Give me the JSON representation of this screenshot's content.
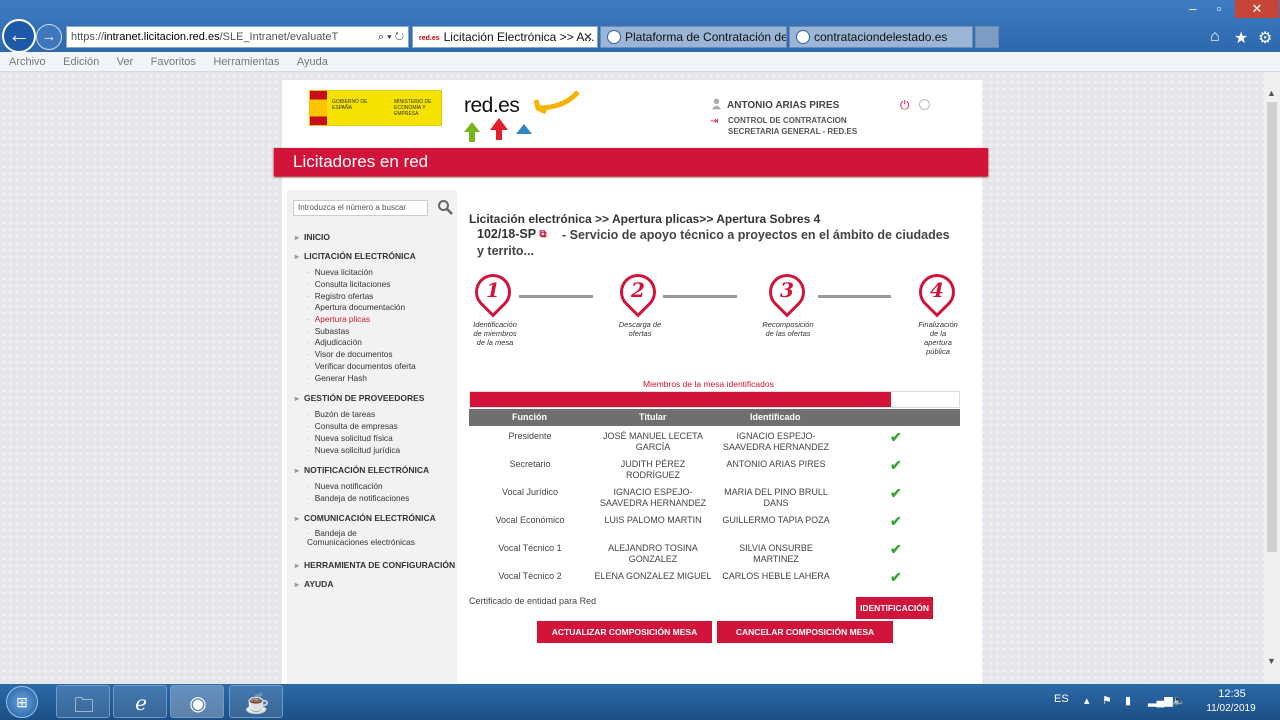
{
  "browser": {
    "address": {
      "prefix": "https://",
      "host": "intranet.licitacion.red.es",
      "path": "/SLE_Intranet/evaluateT",
      "controls": "⌕ ▾ ↻"
    },
    "tabs": [
      {
        "label": "Licitación Electrónica >> A...",
        "fav": "red.es",
        "active": true
      },
      {
        "label": "Plataforma de Contratación de...",
        "active": false
      },
      {
        "label": "contrataciondelestado.es",
        "active": false
      }
    ],
    "menu": [
      "Archivo",
      "Edición",
      "Ver",
      "Favoritos",
      "Herramientas",
      "Ayuda"
    ]
  },
  "header": {
    "gov_text_1": "GOBIERNO DE ESPAÑA",
    "gov_text_2": "MINISTERIO DE ECONOMÍA Y EMPRESA",
    "brand": "red.es",
    "user_name": "ANTONIO ARIAS PIRES",
    "user_role_1": "CONTROL DE CONTRATACION",
    "user_role_2": "SECRETARIA GENERAL  -  RED.ES"
  },
  "section_title": "Licitadores en red",
  "sidebar": {
    "search_placeholder": "Introduzca el número a buscar",
    "sections": [
      {
        "label": "INICIO",
        "items": []
      },
      {
        "label": "LICITACIÓN ELECTRÓNICA",
        "items": [
          "Nueva licitación",
          "Consulta licitaciones",
          "Registro ofertas",
          "Apertura documentación",
          "Apertura plicas",
          "Subastas",
          "Adjudicación",
          "Visor de documentos",
          "Verificar documentos oferta",
          "Generar Hash"
        ]
      },
      {
        "label": "GESTIÓN DE PROVEEDORES",
        "items": [
          "Buzón de tareas",
          "Consulta de empresas",
          "Nueva solicitud física",
          "Nueva solicitud jurídica"
        ]
      },
      {
        "label": "NOTIFICACIÓN ELECTRÓNICA",
        "items": [
          "Nueva notificación",
          "Bandeja de notificaciones"
        ]
      },
      {
        "label": "COMUNICACIÓN ELECTRÓNICA",
        "items": [
          "Bandeja de Comunicaciones electrónicas"
        ]
      },
      {
        "label": "HERRAMIENTA DE CONFIGURACIÓN",
        "items": []
      },
      {
        "label": "AYUDA",
        "items": []
      }
    ],
    "selected_item": "Apertura plicas"
  },
  "main": {
    "breadcrumb": "Licitación electrónica >> Apertura plicas>> Apertura Sobres 4",
    "expediente_id": "102/18-SP",
    "expediente_title": " -  Servicio de apoyo técnico a proyectos en el ámbito de ciudades y territo...",
    "steps": [
      {
        "num": "1",
        "label": "Identificación de miembros de la mesa"
      },
      {
        "num": "2",
        "label": "Descarga de ofertas"
      },
      {
        "num": "3",
        "label": "Recomposición de las ofertas"
      },
      {
        "num": "4",
        "label": "Finalización de la apertura pública"
      }
    ],
    "progress_label": "Miembros de la mesa identificados",
    "progress_fraction": 0.86,
    "table": {
      "headers": [
        "Función",
        "Titular",
        "Identificado"
      ],
      "rows": [
        {
          "funcion": "Presidente",
          "titular": "JOSÉ MANUEL LECETA GARCÍA",
          "identificado": "IGNACIO ESPEJO-SAAVEDRA HERNANDEZ"
        },
        {
          "funcion": "Secretario",
          "titular": "JUDITH PÉREZ RODRÍGUEZ",
          "identificado": "ANTONIO ARIAS PIRES"
        },
        {
          "funcion": "Vocal Jurídico",
          "titular": "IGNACIO ESPEJO-SAAVEDRA HERNANDEZ",
          "identificado": "MARIA DEL PINO BRULL DANS"
        },
        {
          "funcion": "Vocal Económico",
          "titular": "LUIS PALOMO MARTIN",
          "identificado": "GUILLERMO TAPIA POZA"
        },
        {
          "funcion": "Vocal Técnico 1",
          "titular": "ALEJANDRO TOSINA GONZALEZ",
          "identificado": "SILVIA ONSURBE MARTINEZ"
        },
        {
          "funcion": "Vocal Técnico 2",
          "titular": "ELENA GONZALEZ MIGUEL",
          "identificado": "CARLOS HEBLE LAHERA"
        }
      ]
    },
    "cert_label": "Certificado de entidad para Red",
    "btn_identificacion": "IDENTIFICACIÓN",
    "btn_actualizar": "ACTUALIZAR COMPOSICIÓN MESA",
    "btn_cancelar": "CANCELAR COMPOSICIÓN MESA"
  },
  "taskbar": {
    "lang": "ES",
    "time": "12:35",
    "date": "11/02/2019"
  },
  "colors": {
    "accent": "#d2143a",
    "check": "#3aa535"
  }
}
